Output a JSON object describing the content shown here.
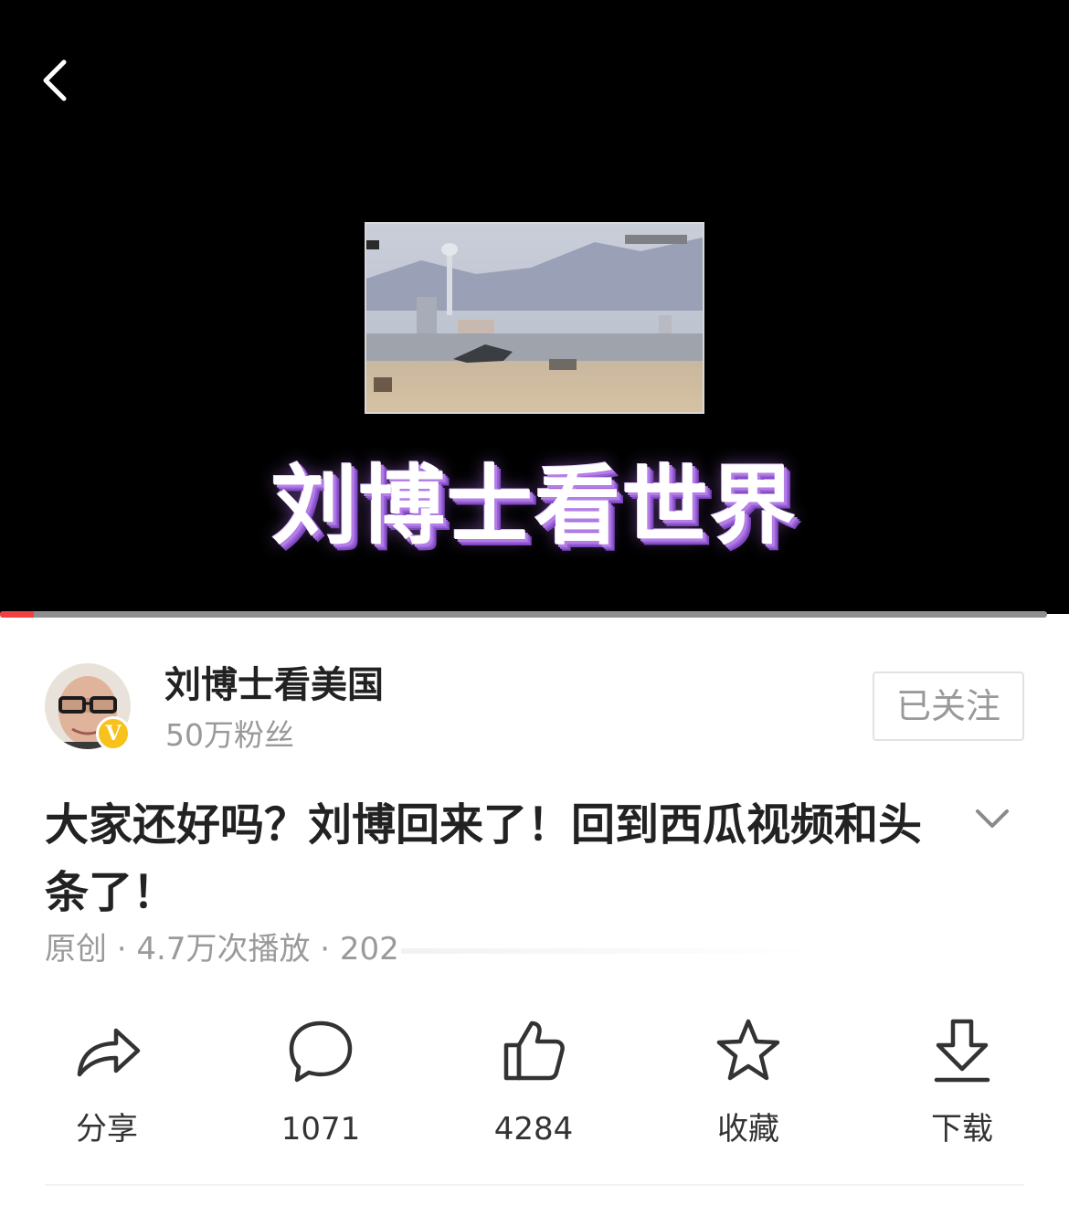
{
  "player": {
    "overlay_text": "刘博士看世界",
    "progress_fraction": 0.032
  },
  "author": {
    "name": "刘博士看美国",
    "fans": "50万粉丝",
    "verified_badge": "V",
    "follow_label": "已关注"
  },
  "video": {
    "title": "大家还好吗？刘博回来了！回到西瓜视频和头条了！",
    "meta": "原创 · 4.7万次播放 · 202"
  },
  "actions": [
    {
      "icon": "share-icon",
      "label": "分享"
    },
    {
      "icon": "comment-icon",
      "label": "1071"
    },
    {
      "icon": "like-icon",
      "label": "4284"
    },
    {
      "icon": "star-icon",
      "label": "收藏"
    },
    {
      "icon": "download-icon",
      "label": "下载"
    }
  ],
  "colors": {
    "accent": "#f04142",
    "verified": "#f6c21b",
    "overlay_glow": "#b37fe6"
  }
}
